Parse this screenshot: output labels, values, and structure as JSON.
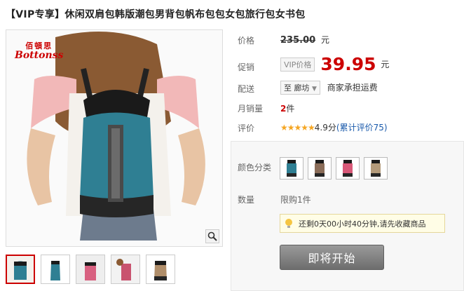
{
  "product": {
    "title": "【VIP专享】休闲双肩包韩版潮包男背包帆布包包女包旅行包女书包",
    "brand_logo_cn": "佰頓思",
    "brand_logo_en": "Bottonss"
  },
  "price_section": {
    "price_label": "价格",
    "original_price": "235.00",
    "currency_unit": "元",
    "promo_label": "促销",
    "vip_tag": "VIP价格",
    "promo_price": "39.95",
    "promo_unit": "元",
    "shipping_label": "配送",
    "shipping_to": "至 廊坊",
    "shipping_note": "商家承担运费",
    "sales_label": "月销量",
    "sales_count": "2",
    "sales_unit": "件",
    "rating_label": "评价",
    "rating_stars": "★★★★★",
    "rating_score": "4.9分",
    "rating_link": "(累计评价75)"
  },
  "purchase": {
    "color_label": "颜色分类",
    "swatches": [
      "blue",
      "brown",
      "pink",
      "khaki"
    ],
    "quantity_label": "数量",
    "quantity_value": "限购1件",
    "notice": "还剩0天00小时40分钟,请先收藏商品",
    "button_label": "即将开始"
  },
  "colors": {
    "price_red": "#cc0000",
    "link_blue": "#1a5aab",
    "button_gray": "#7a7a7a"
  }
}
